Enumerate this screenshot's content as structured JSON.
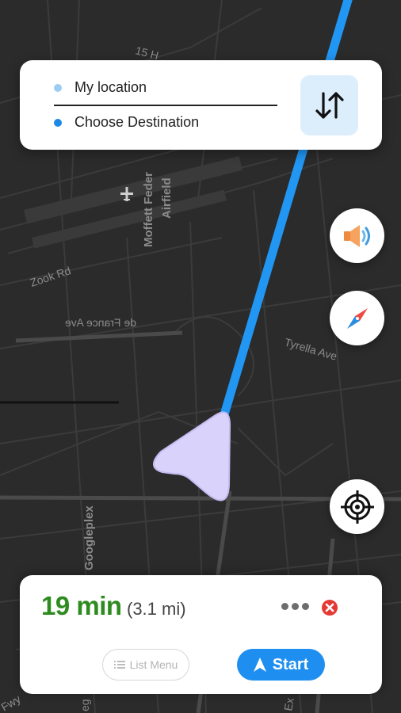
{
  "map": {
    "labels": {
      "street_15": "15 H",
      "moffett": "Moffett Feder",
      "airfield": "Airfield",
      "zook": "Zook Rd",
      "de_france": "de France Ave",
      "tyrella": "Tyrella Ave",
      "googleplex": "Googleplex",
      "fwy": "Fwy",
      "ex": "Ex",
      "eg": "eg"
    },
    "colors": {
      "route": "#2196f3",
      "background": "#2b2b2b",
      "roads": "#3a3a3a",
      "arrow": "#d9d3fb"
    }
  },
  "route_card": {
    "origin_label": "My location",
    "destination_label": "Choose Destination",
    "swap_icon": "swap-vertical-icon"
  },
  "fabs": {
    "sound_icon": "speaker-icon",
    "compass_icon": "compass-icon",
    "locate_icon": "crosshair-icon"
  },
  "trip": {
    "eta": "19 min",
    "distance": "(3.1 mi)",
    "list_menu_label": "List Menu",
    "start_label": "Start",
    "colors": {
      "eta": "#2e8b1f",
      "start": "#1e8ff0",
      "close": "#e53935"
    }
  }
}
